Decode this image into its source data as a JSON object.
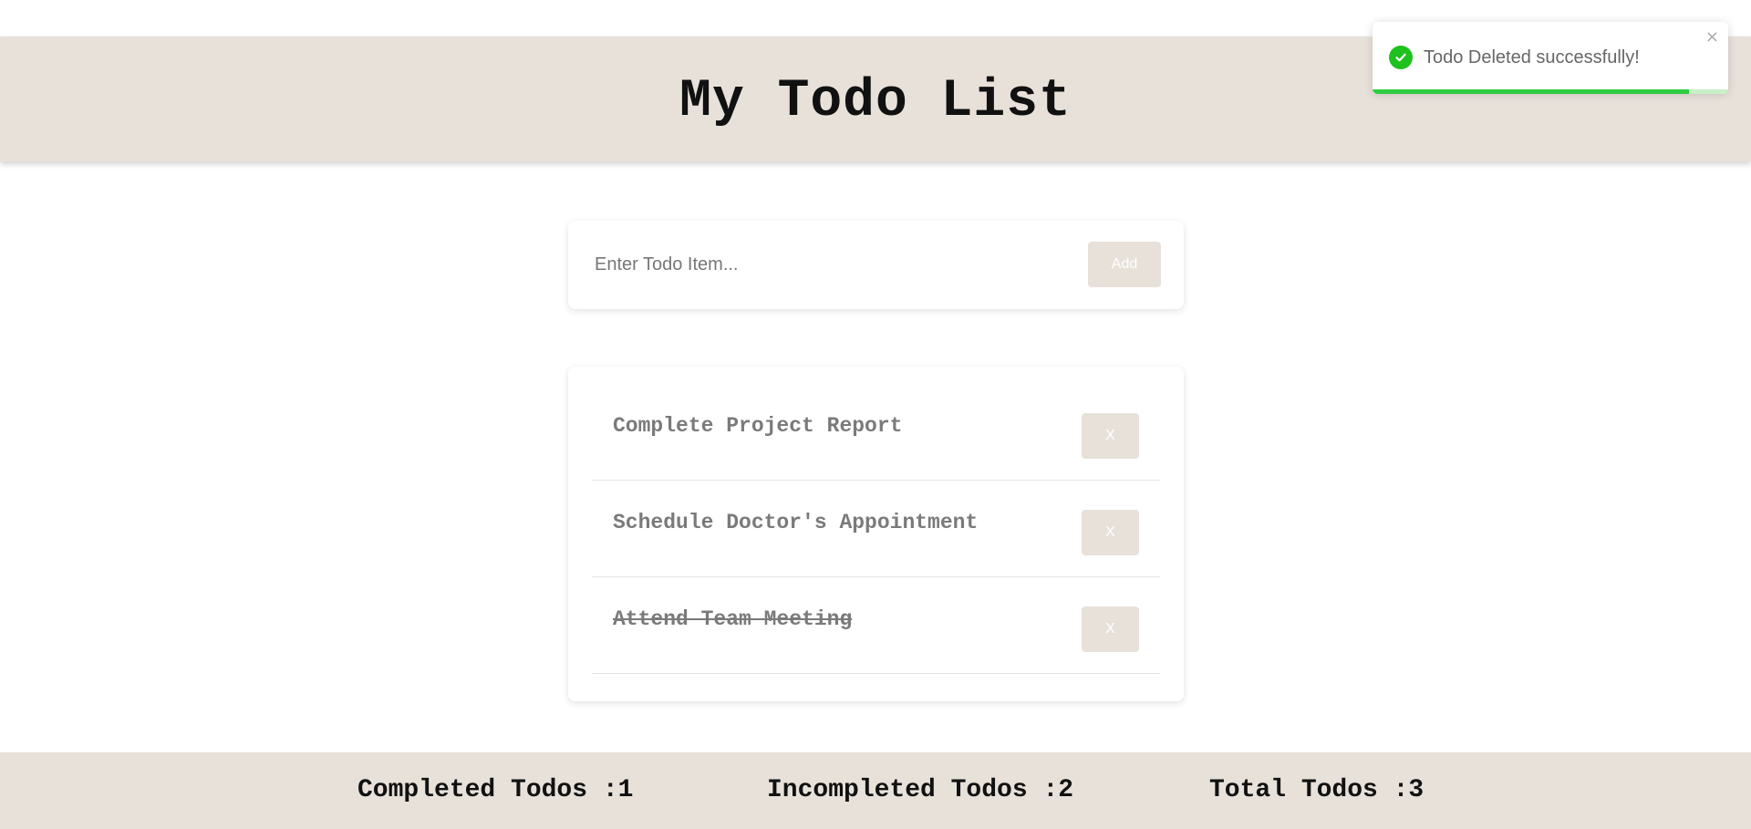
{
  "header": {
    "title": "My Todo List"
  },
  "add_form": {
    "placeholder": "Enter Todo Item...",
    "value": "",
    "add_label": "Add"
  },
  "todos": [
    {
      "text": "Complete Project Report",
      "completed": false,
      "delete_label": "X"
    },
    {
      "text": "Schedule Doctor's Appointment",
      "completed": false,
      "delete_label": "X"
    },
    {
      "text": "Attend Team Meeting",
      "completed": true,
      "delete_label": "X"
    }
  ],
  "footer": {
    "completed": "Completed Todos :1",
    "incompleted": "Incompleted Todos :2",
    "total": "Total Todos :3"
  },
  "toast": {
    "message": "Todo Deleted successfully!",
    "close_glyph": "×",
    "icon": "check-circle-icon",
    "progress": 0.89,
    "color": "#1ec11e"
  },
  "colors": {
    "accent": "#e8e1da",
    "muted_text": "#7a7a7a"
  }
}
